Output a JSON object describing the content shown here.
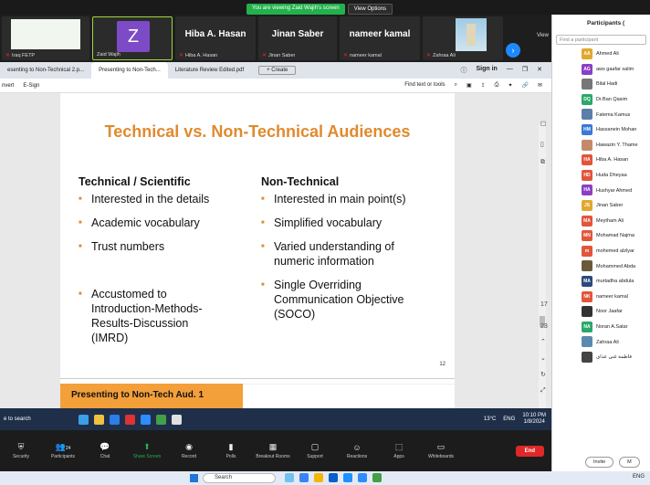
{
  "banner": {
    "message": "You are viewing Zaid Wajih's screen",
    "options": "View Options"
  },
  "gallery": {
    "tiles": [
      {
        "name": "Iraq FETP",
        "kind": "doc"
      },
      {
        "name": "Zaid Wajih",
        "kind": "avatar",
        "initial": "Z"
      },
      {
        "name": "Hiba A. Hasan",
        "kind": "name"
      },
      {
        "name": "Jinan Saber",
        "kind": "name"
      },
      {
        "name": "nameer kamal",
        "kind": "name"
      },
      {
        "name": "Zahraa Ali",
        "kind": "photo"
      }
    ],
    "view_label": "View"
  },
  "browser": {
    "tabs": [
      "esenting to Non-Technical 2.p...",
      "Presenting to Non-Tech...",
      "Literature Review Edited.pdf"
    ],
    "new_tab": "+ Create",
    "sign_in": "Sign in",
    "toolbar_left": [
      "nvert",
      "E-Sign"
    ],
    "find": "Find text or tools"
  },
  "slide": {
    "title": "Technical vs. Non-Technical Audiences",
    "left_heading": "Technical / Scientific",
    "left_items": [
      "Interested in the details",
      "Academic vocabulary",
      "Trust numbers",
      "Accustomed to Introduction-Methods-Results-Discussion (IMRD)"
    ],
    "right_heading": "Non-Technical",
    "right_items": [
      "Interested in main point(s)",
      "Simplified vocabulary",
      "Varied understanding of numeric information",
      "Single Overriding Communication Objective (SOCO)"
    ],
    "page_number": "12",
    "footer": "Presenting to Non-Tech Aud. 1"
  },
  "page_nav": {
    "current": "17",
    "total": "23"
  },
  "win_taskbar": {
    "search": "e to search",
    "weather": "13°C",
    "lang": "ENG",
    "time": "10:10 PM",
    "date": "1/8/2024"
  },
  "zoom_controls": {
    "items": [
      "Security",
      "Participants",
      "Chat",
      "Share Screen",
      "Record",
      "Polls",
      "Breakout Rooms",
      "Support",
      "Reactions",
      "Apps",
      "Whiteboards"
    ],
    "participants_count": "24",
    "end": "End"
  },
  "participants": {
    "title": "Participants (",
    "search_placeholder": "Find a participant",
    "list": [
      {
        "initials": "AA",
        "name": "Ahmed Ali",
        "color": "#e0a82e"
      },
      {
        "initials": "AG",
        "name": "aws gaafar salim",
        "color": "#8a3fc6"
      },
      {
        "initials": "",
        "name": "Bilal Hadi",
        "color": "#777777"
      },
      {
        "initials": "DQ",
        "name": "Dr.Ban Qasim",
        "color": "#2aa86a"
      },
      {
        "initials": "",
        "name": "Fatema Kamus",
        "color": "#5b7fa8"
      },
      {
        "initials": "HM",
        "name": "Hassanein Mohan",
        "color": "#3b78d8"
      },
      {
        "initials": "",
        "name": "Hawazin Y. Thame",
        "color": "#c58a6a"
      },
      {
        "initials": "HA",
        "name": "Hiba A. Hasan",
        "color": "#e2553a"
      },
      {
        "initials": "HD",
        "name": "Huda Dheyaa",
        "color": "#e2553a"
      },
      {
        "initials": "HA",
        "name": "Hushyar Ahmed",
        "color": "#8a3fc6"
      },
      {
        "initials": "JS",
        "name": "Jinan Saber",
        "color": "#e0a82e"
      },
      {
        "initials": "MA",
        "name": "Meytham Ali",
        "color": "#e2553a"
      },
      {
        "initials": "MN",
        "name": "Mohamad Najma",
        "color": "#e2553a"
      },
      {
        "initials": "m",
        "name": "mohemed alzlyar",
        "color": "#e2553a"
      },
      {
        "initials": "",
        "name": "Mohammed Abda",
        "color": "#6a5a3a"
      },
      {
        "initials": "MA",
        "name": "murtadha abdula",
        "color": "#2b4a7a"
      },
      {
        "initials": "NK",
        "name": "nameer kamal",
        "color": "#e2553a"
      },
      {
        "initials": "",
        "name": "Noor Jaafar",
        "color": "#333333"
      },
      {
        "initials": "NA",
        "name": "Noran A.Satar",
        "color": "#2aa86a"
      },
      {
        "initials": "",
        "name": "Zahraa Ali",
        "color": "#5a8ab0"
      },
      {
        "initials": "",
        "name": "فاطمة غنى عداى",
        "color": "#444444"
      }
    ],
    "invite": "Invite",
    "mute": "M"
  },
  "host_taskbar": {
    "search": "Search",
    "lang": "ENG"
  },
  "colors": {
    "accent": "#e08a2e",
    "zoom_green": "#23b14d",
    "end_red": "#e02828"
  }
}
